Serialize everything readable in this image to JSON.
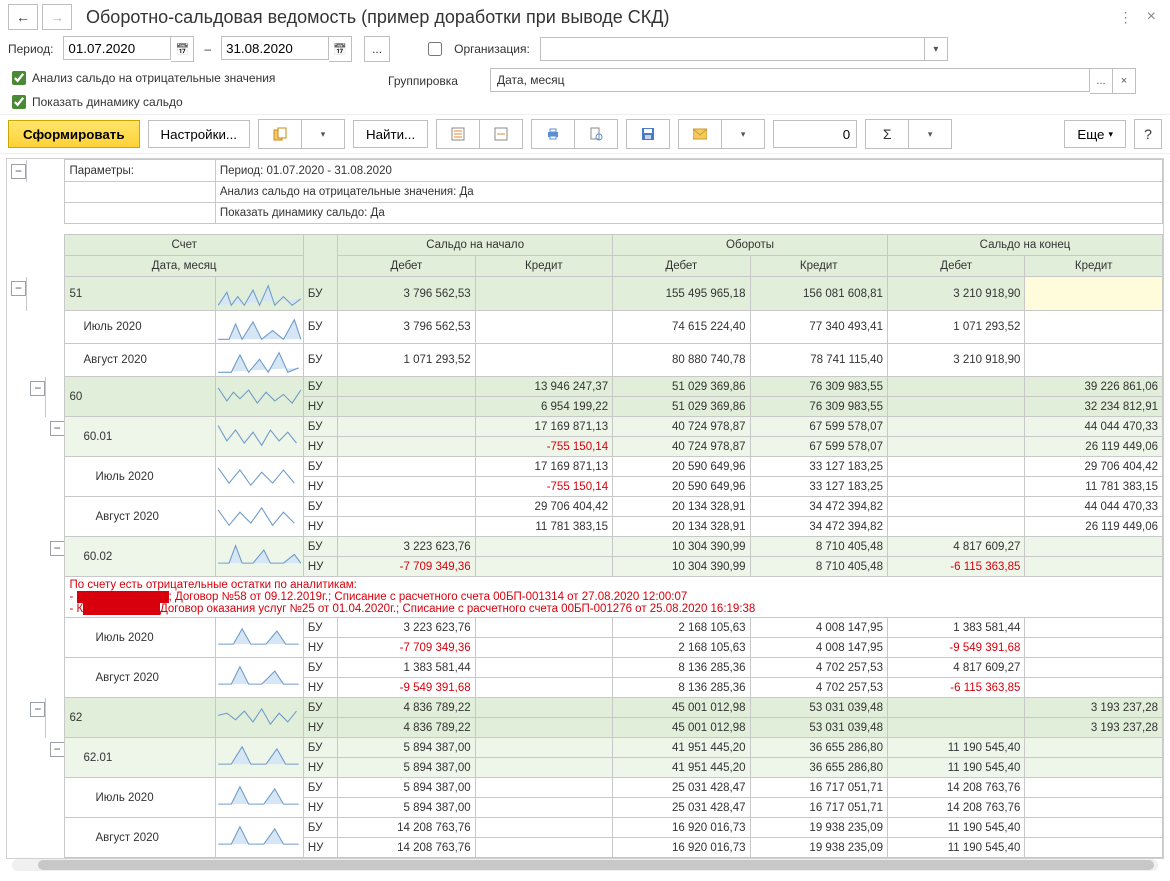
{
  "title": "Оборотно-сальдовая ведомость (пример доработки при выводе СКД)",
  "period": {
    "label": "Период:",
    "from": "01.07.2020",
    "to": "31.08.2020",
    "dash": "–"
  },
  "org": {
    "label": "Организация:"
  },
  "checks": {
    "analysis": "Анализ сальдо на отрицательные значения",
    "dynamics": "Показать динамику сальдо"
  },
  "grouping": {
    "label": "Группировка",
    "value": "Дата, месяц"
  },
  "toolbar": {
    "form": "Сформировать",
    "settings": "Настройки...",
    "find": "Найти...",
    "num": "0",
    "more": "Еще"
  },
  "params": {
    "label": "Параметры:",
    "line1": "Период: 01.07.2020 - 31.08.2020",
    "line2": "Анализ сальдо на отрицательные значения: Да",
    "line3": "Показать динамику сальдо: Да"
  },
  "headers": {
    "account": "Счет",
    "date": "Дата, месяц",
    "start": "Сальдо на начало",
    "turnover": "Обороты",
    "end": "Сальдо на конец",
    "debit": "Дебет",
    "credit": "Кредит"
  },
  "bu": "БУ",
  "nu": "НУ",
  "rows": {
    "r51": {
      "acct": "51",
      "sd": "3 796 562,53",
      "sc": "",
      "td": "155 495 965,18",
      "tc": "156 081 608,81",
      "ed": "3 210 918,90",
      "ec": ""
    },
    "r51jul": {
      "acct": "Июль 2020",
      "sd": "3 796 562,53",
      "sc": "",
      "td": "74 615 224,40",
      "tc": "77 340 493,41",
      "ed": "1 071 293,52",
      "ec": ""
    },
    "r51aug": {
      "acct": "Август 2020",
      "sd": "1 071 293,52",
      "sc": "",
      "td": "80 880 740,78",
      "tc": "78 741 115,40",
      "ed": "3 210 918,90",
      "ec": ""
    },
    "r60bu": {
      "acct": "60",
      "sd": "",
      "sc": "13 946 247,37",
      "td": "51 029 369,86",
      "tc": "76 309 983,55",
      "ed": "",
      "ec": "39 226 861,06"
    },
    "r60nu": {
      "sd": "",
      "sc": "6 954 199,22",
      "td": "51 029 369,86",
      "tc": "76 309 983,55",
      "ed": "",
      "ec": "32 234 812,91"
    },
    "r6001bu": {
      "acct": "60.01",
      "sd": "",
      "sc": "17 169 871,13",
      "td": "40 724 978,87",
      "tc": "67 599 578,07",
      "ed": "",
      "ec": "44 044 470,33"
    },
    "r6001nu": {
      "sd": "",
      "sc": "-755 150,14",
      "td": "40 724 978,87",
      "tc": "67 599 578,07",
      "ed": "",
      "ec": "26 119 449,06"
    },
    "r6001julbu": {
      "acct": "Июль 2020",
      "sd": "",
      "sc": "17 169 871,13",
      "td": "20 590 649,96",
      "tc": "33 127 183,25",
      "ed": "",
      "ec": "29 706 404,42"
    },
    "r6001julnu": {
      "sd": "",
      "sc": "-755 150,14",
      "td": "20 590 649,96",
      "tc": "33 127 183,25",
      "ed": "",
      "ec": "11 781 383,15"
    },
    "r6001augbu": {
      "acct": "Август 2020",
      "sd": "",
      "sc": "29 706 404,42",
      "td": "20 134 328,91",
      "tc": "34 472 394,82",
      "ed": "",
      "ec": "44 044 470,33"
    },
    "r6001augnu": {
      "sd": "",
      "sc": "11 781 383,15",
      "td": "20 134 328,91",
      "tc": "34 472 394,82",
      "ed": "",
      "ec": "26 119 449,06"
    },
    "r6002bu": {
      "acct": "60.02",
      "sd": "3 223 623,76",
      "sc": "",
      "td": "10 304 390,99",
      "tc": "8 710 405,48",
      "ed": "4 817 609,27",
      "ec": ""
    },
    "r6002nu": {
      "sd": "-7 709 349,36",
      "sc": "",
      "td": "10 304 390,99",
      "tc": "8 710 405,48",
      "ed": "-6 115 363,85",
      "ec": ""
    },
    "r6002julbu": {
      "acct": "Июль 2020",
      "sd": "3 223 623,76",
      "sc": "",
      "td": "2 168 105,63",
      "tc": "4 008 147,95",
      "ed": "1 383 581,44",
      "ec": ""
    },
    "r6002julnu": {
      "sd": "-7 709 349,36",
      "sc": "",
      "td": "2 168 105,63",
      "tc": "4 008 147,95",
      "ed": "-9 549 391,68",
      "ec": ""
    },
    "r6002augbu": {
      "acct": "Август 2020",
      "sd": "1 383 581,44",
      "sc": "",
      "td": "8 136 285,36",
      "tc": "4 702 257,53",
      "ed": "4 817 609,27",
      "ec": ""
    },
    "r6002augnu": {
      "sd": "-9 549 391,68",
      "sc": "",
      "td": "8 136 285,36",
      "tc": "4 702 257,53",
      "ed": "-6 115 363,85",
      "ec": ""
    },
    "r62bu": {
      "acct": "62",
      "sd": "4 836 789,22",
      "sc": "",
      "td": "45 001 012,98",
      "tc": "53 031 039,48",
      "ed": "",
      "ec": "3 193 237,28"
    },
    "r62nu": {
      "sd": "4 836 789,22",
      "sc": "",
      "td": "45 001 012,98",
      "tc": "53 031 039,48",
      "ed": "",
      "ec": "3 193 237,28"
    },
    "r6201bu": {
      "acct": "62.01",
      "sd": "5 894 387,00",
      "sc": "",
      "td": "41 951 445,20",
      "tc": "36 655 286,80",
      "ed": "11 190 545,40",
      "ec": ""
    },
    "r6201nu": {
      "sd": "5 894 387,00",
      "sc": "",
      "td": "41 951 445,20",
      "tc": "36 655 286,80",
      "ed": "11 190 545,40",
      "ec": ""
    },
    "r6201julbu": {
      "acct": "Июль 2020",
      "sd": "5 894 387,00",
      "sc": "",
      "td": "25 031 428,47",
      "tc": "16 717 051,71",
      "ed": "14 208 763,76",
      "ec": ""
    },
    "r6201julnu": {
      "sd": "5 894 387,00",
      "sc": "",
      "td": "25 031 428,47",
      "tc": "16 717 051,71",
      "ed": "14 208 763,76",
      "ec": ""
    },
    "r6201augbu": {
      "acct": "Август 2020",
      "sd": "14 208 763,76",
      "sc": "",
      "td": "16 920 016,73",
      "tc": "19 938 235,09",
      "ed": "11 190 545,40",
      "ec": ""
    },
    "r6201augnu": {
      "sd": "14 208 763,76",
      "sc": "",
      "td": "16 920 016,73",
      "tc": "19 938 235,09",
      "ed": "11 190 545,40",
      "ec": ""
    }
  },
  "warning": {
    "title": "По счету есть отрицательные остатки по аналитикам:",
    "l1a": "- ",
    "l1b": "; Договор №58 от 09.12.2019г.; Списание с расчетного счета 00БП-001314 от 27.08.2020 12:00:07",
    "l2a": "- К",
    "l2b": "Договор оказания услуг №25 от 01.04.2020г.; Списание с расчетного счета 00БП-001276 от 25.08.2020 16:19:38"
  }
}
